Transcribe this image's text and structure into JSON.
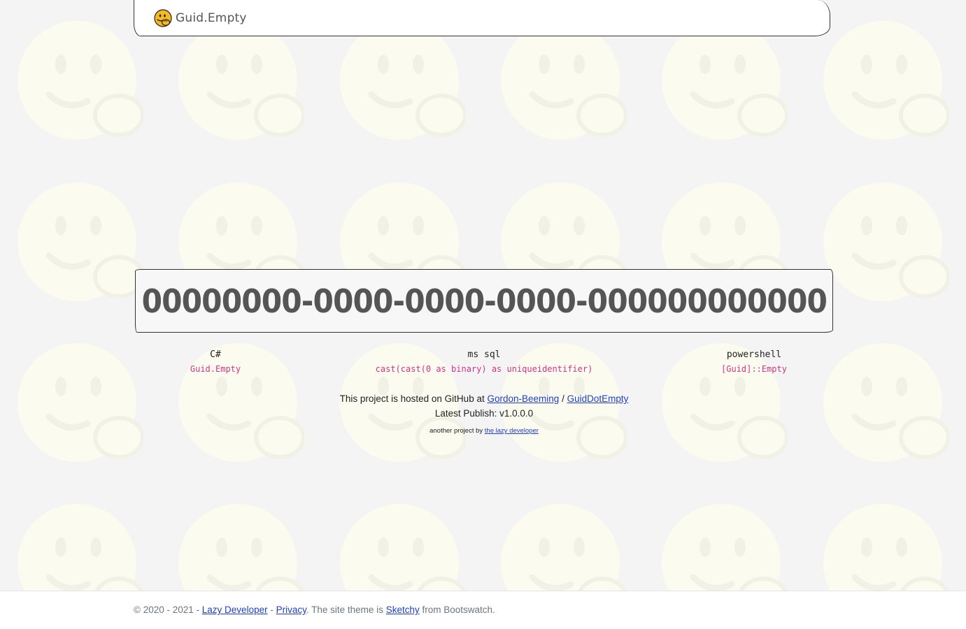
{
  "navbar": {
    "brand_text": "Guid.Empty",
    "brand_icon": "face-with-hand-over-mouth-icon"
  },
  "guid": {
    "value": "00000000-0000-0000-0000-000000000000"
  },
  "code_examples": [
    {
      "language": "C#",
      "snippet": "Guid.Empty"
    },
    {
      "language": "ms sql",
      "snippet": "cast(cast(0 as binary) as uniqueidentifier)"
    },
    {
      "language": "powershell",
      "snippet": "[Guid]::Empty"
    }
  ],
  "info": {
    "hosted_prefix": "This project is hosted on GitHub at",
    "github_user": "Gordon-Beeming",
    "separator": "/",
    "github_repo": "GuidDotEmpty",
    "publish_label": "Latest Publish:",
    "publish_version": "v1.0.0.0",
    "another_project_prefix": "another project by",
    "lazy_developer_link": "the lazy developer"
  },
  "footer": {
    "copyright": "© 2020 - 2021 -",
    "lazy_developer": "Lazy Developer",
    "dash": "-",
    "privacy": "Privacy",
    "theme_text": ". The site theme is",
    "sketchy": "Sketchy",
    "from_text": "from Bootswatch."
  },
  "colors": {
    "background": "#f4f4f5",
    "smiley_pattern": "#fbfbef",
    "code_snippet": "#d63384",
    "link": "#1e40c8",
    "footer_text": "#6c757d"
  }
}
